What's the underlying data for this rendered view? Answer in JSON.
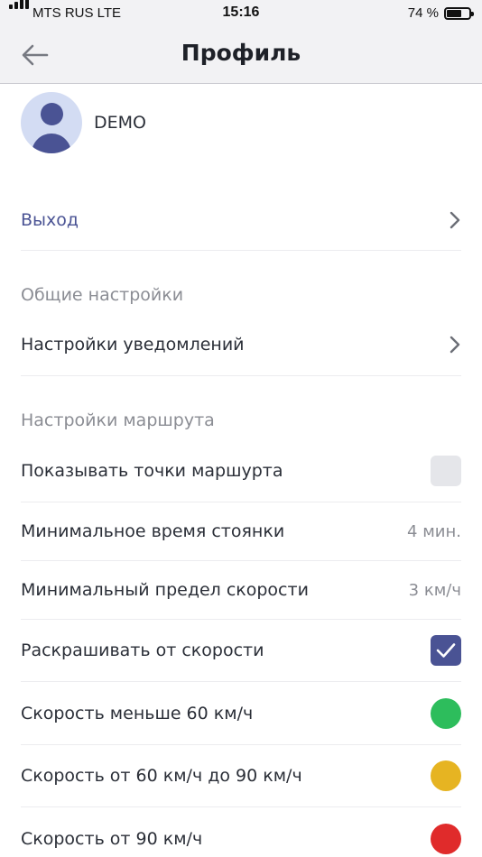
{
  "status_bar": {
    "carrier": "MTS RUS  LTE",
    "time": "15:16",
    "battery_pct": "74 %",
    "battery_level": 0.74
  },
  "navbar": {
    "title": "Профиль",
    "back_icon": "arrow-left-icon"
  },
  "profile": {
    "name": "DEMO",
    "avatar_icon": "user-avatar-icon"
  },
  "logout": {
    "label": "Выход"
  },
  "general": {
    "header": "Общие настройки",
    "notifications_label": "Настройки уведомлений"
  },
  "route": {
    "header": "Настройки маршрута",
    "show_points": {
      "label": "Показывать точки маршурта",
      "checked": false
    },
    "min_stop": {
      "label": "Минимальное время стоянки",
      "value": "4 мин."
    },
    "min_speed": {
      "label": "Минимальный предел скорости",
      "value": "3 км/ч"
    },
    "color_by_speed": {
      "label": "Раскрашивать от скорости",
      "checked": true
    },
    "speeds": [
      {
        "label": "Скорость меньше 60 км/ч",
        "color": "#2dbd5c"
      },
      {
        "label": "Скорость от 60 км/ч до 90 км/ч",
        "color": "#e6b422"
      },
      {
        "label": "Скорость от 90 км/ч",
        "color": "#e02b2b"
      }
    ]
  },
  "colors": {
    "accent": "#4a5394",
    "link": "#4a5394",
    "muted": "#8b8d94"
  }
}
